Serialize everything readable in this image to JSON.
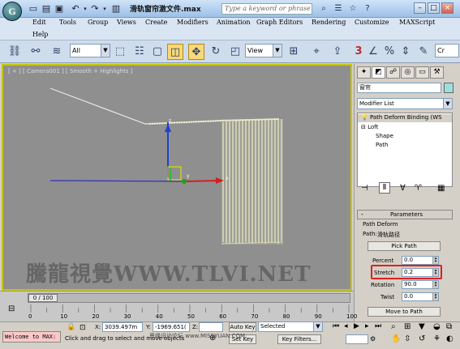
{
  "titlebar": {
    "title": "滑轨窗帘激文件.max",
    "search_placeholder": "Type a keyword or phrase",
    "logo_letter": "G"
  },
  "menu": [
    "Edit",
    "Tools",
    "Group",
    "Views",
    "Create",
    "Modifiers",
    "Animation",
    "Graph Editors",
    "Rendering",
    "Customize",
    "MAXScript",
    "Help"
  ],
  "toolbar": {
    "selection_filter": "All",
    "reference_coord": "View",
    "snap_value": "3"
  },
  "viewport": {
    "label": "[ + ] [ Camera001 ] [ Smooth + Highlights ]",
    "watermark": "騰龍視覺WWW.TLVI.NET"
  },
  "command_panel": {
    "object_name": "窗帘",
    "modifier_list": "Modifier List",
    "stack": [
      {
        "label": "Path Deform Binding (WS",
        "indent": 0
      },
      {
        "label": "Loft",
        "indent": 0
      },
      {
        "label": "Shape",
        "indent": 1
      },
      {
        "label": "Path",
        "indent": 1
      }
    ],
    "rollout_title": "Parameters",
    "group_title": "Path Deform",
    "path_label": "Path:",
    "path_value": "滑轨路径",
    "pick_path": "Pick Path",
    "percent_label": "Percent",
    "percent_value": "0.0",
    "stretch_label": "Stretch",
    "stretch_value": "0.2",
    "rotation_label": "Rotation",
    "rotation_value": "90.0",
    "twist_label": "Twist",
    "twist_value": "0.0",
    "move_to_path": "Move to Path"
  },
  "timeline": {
    "frame": "0 / 100",
    "ticks": [
      "0",
      "10",
      "20",
      "30",
      "40",
      "50",
      "60",
      "70",
      "80",
      "90",
      "100"
    ]
  },
  "status": {
    "welcome": "Welcome to MAX:",
    "x_label": "X:",
    "x_value": "3039.497m",
    "y_label": "Y:",
    "y_value": "-1969.651(",
    "z_label": "Z:",
    "autokey": "Auto Key",
    "selected": "Selected",
    "setkey": "Set Key",
    "keyfilters": "Key Filters...",
    "prompt": "Click and drag to select and move objects",
    "site": "思缘设计论坛 www.MISSYUAN.COM"
  },
  "colors": {
    "viewport_bg": "#8f8f8f",
    "viewport_border": "#c7c700",
    "highlight_box": "#e02020",
    "curtain": "#e8e8c0"
  }
}
